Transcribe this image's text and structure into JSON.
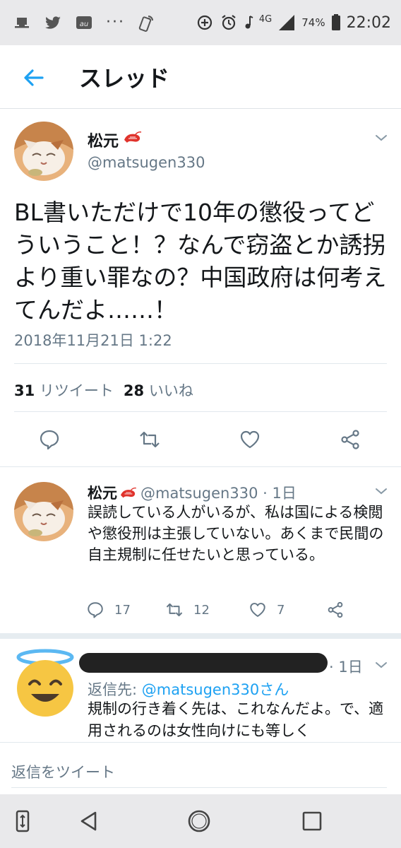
{
  "status_bar": {
    "battery": "74%",
    "time": "22:02",
    "network": "4G",
    "icons": [
      "notification-icon",
      "twitter-icon",
      "au-icon",
      "more-dots",
      "nfc-icon",
      "add-circle-icon",
      "alarm-icon",
      "music-icon",
      "signal-icon",
      "battery-icon"
    ],
    "dots": "···"
  },
  "header": {
    "title": "スレッド",
    "back_icon": "back-arrow-icon"
  },
  "main_tweet": {
    "name": "松元",
    "handle": "@matsugen330",
    "text": "BL書いただけで10年の懲役ってどういうこと！？なんで窃盗とか誘拐より重い罪なの？中国政府は何考えてんだよ……！",
    "date": "2018年11月21日 1:22",
    "retweet_count": "31",
    "retweet_label": "リツイート",
    "like_count": "28",
    "like_label": "いいね"
  },
  "reply1": {
    "name": "松元",
    "handle_time": "@matsugen330 · 1日",
    "text": "誤読している人がいるが、私は国による検閲や懲役刑は主張していない。あくまで民間の自主規制に任せたいと思っている。",
    "reply_count": "17",
    "retweet_count": "12",
    "like_count": "7"
  },
  "reply2": {
    "time": "· 1日",
    "reply_to_label": "返信先:",
    "reply_to_mention": "@matsugen330さん",
    "text": "規制の行き着く先は、これなんだよ。で、適用されるのは女性向けにも等しく"
  },
  "composer": {
    "placeholder": "返信をツイート"
  },
  "colors": {
    "accent": "#1da1f2",
    "text": "#14171a",
    "muted": "#657786",
    "bar": "#e9e9eb"
  }
}
